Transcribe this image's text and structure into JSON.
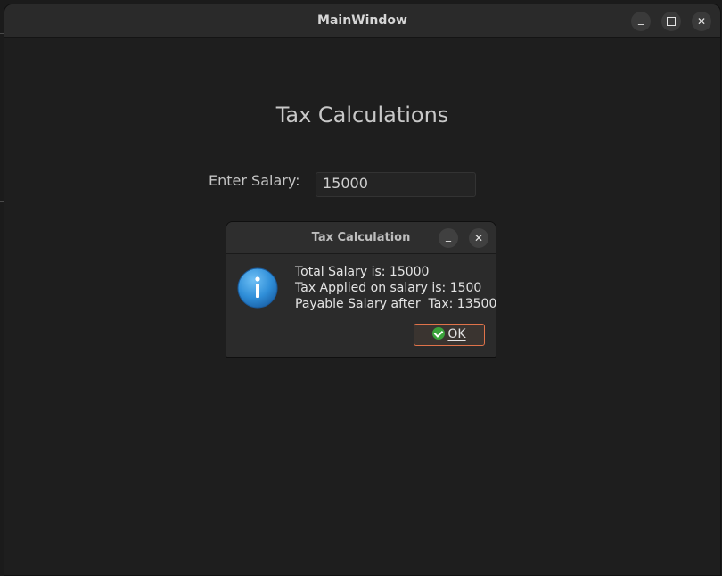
{
  "window": {
    "title": "MainWindow",
    "minimize_glyph": "_",
    "close_glyph": "✕"
  },
  "main": {
    "heading": "Tax Calculations",
    "salary_label": "Enter Salary:",
    "salary_value": "15000"
  },
  "dialog": {
    "title": "Tax Calculation",
    "minimize_glyph": "_",
    "close_glyph": "✕",
    "icon": "information-icon",
    "message": "Total Salary is: 15000\nTax Applied on salary is: 1500\nPayable Salary after  Tax: 13500",
    "ok_label": "OK"
  },
  "colors": {
    "accent": "#e0734a",
    "info_blue": "#2f8ed8",
    "check_green": "#3aa23a"
  }
}
